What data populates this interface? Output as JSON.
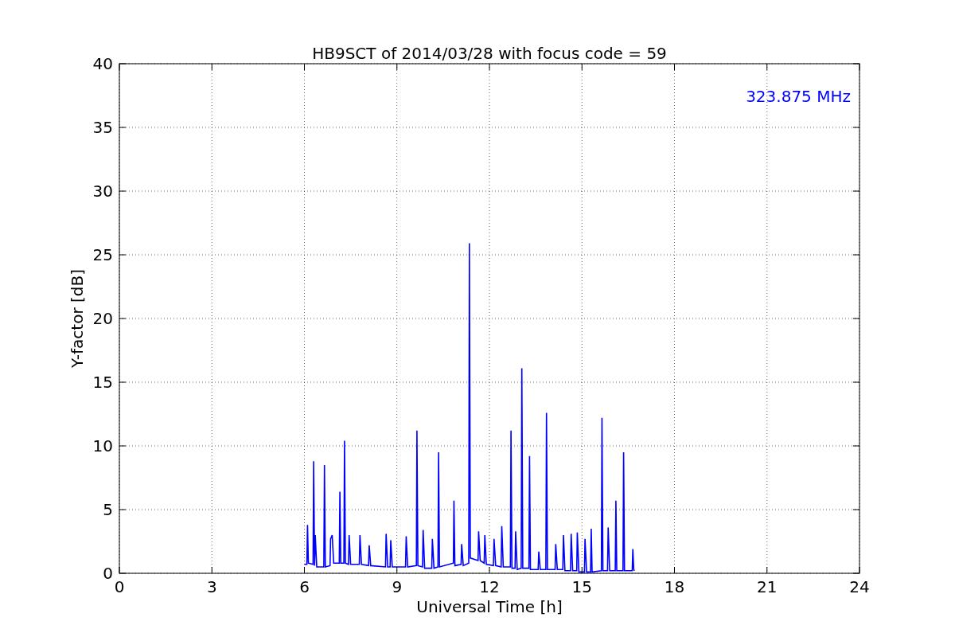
{
  "chart_data": {
    "type": "line",
    "title": "HB9SCT of 2014/03/28 with focus code = 59",
    "xlabel": "Universal Time [h]",
    "ylabel": "Y-factor [dB]",
    "xlim": [
      0,
      24
    ],
    "ylim": [
      0,
      40
    ],
    "grid": true,
    "xticks": [
      0,
      3,
      6,
      9,
      12,
      15,
      18,
      21,
      24
    ],
    "yticks": [
      0,
      5,
      10,
      15,
      20,
      25,
      30,
      35,
      40
    ],
    "annotations": [
      {
        "text": "323.875 MHz"
      }
    ],
    "x": [
      6.0,
      6.08,
      6.1,
      6.13,
      6.28,
      6.3,
      6.33,
      6.35,
      6.4,
      6.63,
      6.65,
      6.68,
      6.83,
      6.85,
      6.9,
      6.95,
      7.13,
      7.15,
      7.18,
      7.28,
      7.3,
      7.33,
      7.43,
      7.45,
      7.5,
      7.78,
      7.8,
      7.85,
      8.08,
      8.1,
      8.15,
      8.63,
      8.65,
      8.7,
      8.78,
      8.8,
      8.85,
      9.28,
      9.3,
      9.35,
      9.63,
      9.65,
      9.68,
      9.83,
      9.85,
      9.9,
      10.13,
      10.15,
      10.2,
      10.33,
      10.35,
      10.38,
      10.83,
      10.85,
      10.88,
      11.08,
      11.1,
      11.15,
      11.33,
      11.35,
      11.38,
      11.63,
      11.65,
      11.7,
      11.83,
      11.85,
      11.9,
      12.13,
      12.15,
      12.2,
      12.38,
      12.4,
      12.45,
      12.68,
      12.7,
      12.73,
      12.83,
      12.85,
      12.9,
      13.03,
      13.05,
      13.08,
      13.28,
      13.3,
      13.33,
      13.58,
      13.6,
      13.65,
      13.83,
      13.85,
      13.88,
      14.13,
      14.15,
      14.2,
      14.38,
      14.4,
      14.45,
      14.63,
      14.65,
      14.7,
      14.83,
      14.85,
      14.9,
      15.08,
      15.1,
      15.15,
      15.28,
      15.3,
      15.33,
      15.63,
      15.65,
      15.68,
      15.83,
      15.85,
      15.9,
      16.08,
      16.1,
      16.13,
      16.33,
      16.35,
      16.38,
      16.63,
      16.65,
      16.68,
      16.7
    ],
    "series": [
      {
        "color": "#0000ff",
        "values": [
          0.7,
          0.7,
          3.8,
          0.8,
          0.7,
          8.8,
          0.6,
          3.0,
          0.5,
          0.5,
          8.5,
          0.5,
          0.6,
          2.7,
          3.0,
          0.8,
          0.8,
          6.4,
          0.8,
          0.8,
          10.4,
          0.8,
          0.7,
          3.0,
          0.7,
          0.7,
          3.0,
          0.7,
          0.6,
          2.2,
          0.6,
          0.5,
          3.1,
          0.5,
          0.5,
          2.6,
          0.5,
          0.5,
          2.9,
          0.5,
          0.6,
          11.2,
          0.6,
          0.5,
          3.4,
          0.4,
          0.4,
          2.7,
          0.4,
          0.5,
          9.5,
          0.5,
          0.8,
          5.7,
          0.6,
          0.7,
          2.3,
          0.6,
          0.8,
          25.9,
          1.2,
          1.0,
          3.3,
          1.0,
          0.8,
          3.0,
          0.7,
          0.6,
          2.7,
          0.6,
          0.5,
          3.7,
          0.5,
          0.5,
          11.2,
          0.4,
          0.4,
          3.3,
          0.3,
          0.4,
          16.1,
          0.4,
          0.4,
          9.2,
          0.3,
          0.3,
          1.7,
          0.3,
          0.3,
          12.6,
          0.3,
          0.3,
          2.3,
          0.3,
          0.3,
          3.0,
          0.2,
          0.2,
          3.1,
          0.2,
          0.2,
          3.2,
          0.1,
          0.1,
          2.7,
          0.1,
          0.1,
          3.5,
          0.1,
          0.2,
          12.2,
          0.2,
          0.2,
          3.6,
          0.2,
          0.2,
          5.7,
          0.2,
          0.2,
          9.5,
          0.2,
          0.2,
          1.9,
          0.3,
          0.2
        ]
      }
    ]
  }
}
